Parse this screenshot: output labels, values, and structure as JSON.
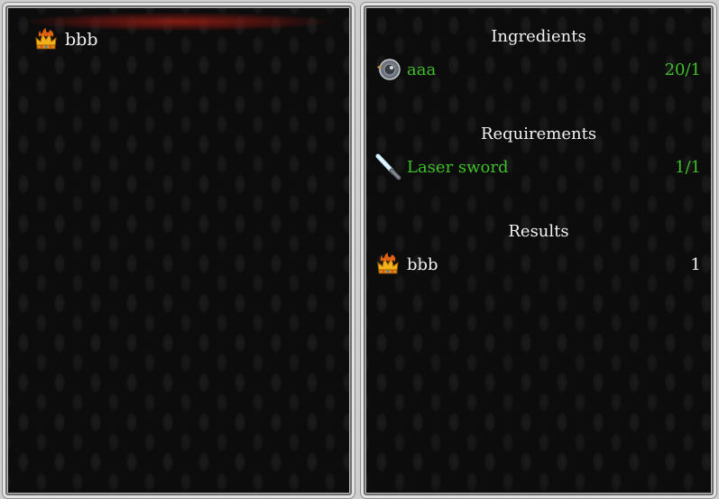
{
  "recipes": [
    {
      "name": "bbb",
      "icon": "crown-fire-icon",
      "selected": true
    }
  ],
  "details": {
    "ingredients_title": "Ingredients",
    "ingredients": [
      {
        "name": "aaa",
        "qty": "20/1",
        "icon": "grey-orb-icon"
      }
    ],
    "requirements_title": "Requirements",
    "requirements": [
      {
        "name": "Laser sword",
        "qty": "1/1",
        "icon": "laser-sword-icon"
      }
    ],
    "results_title": "Results",
    "results": [
      {
        "name": "bbb",
        "qty": "1",
        "icon": "crown-fire-icon"
      }
    ]
  },
  "colors": {
    "satisfied": "#3fbf2a",
    "text": "#f2f2f2",
    "selection_glow": "#961e14"
  }
}
